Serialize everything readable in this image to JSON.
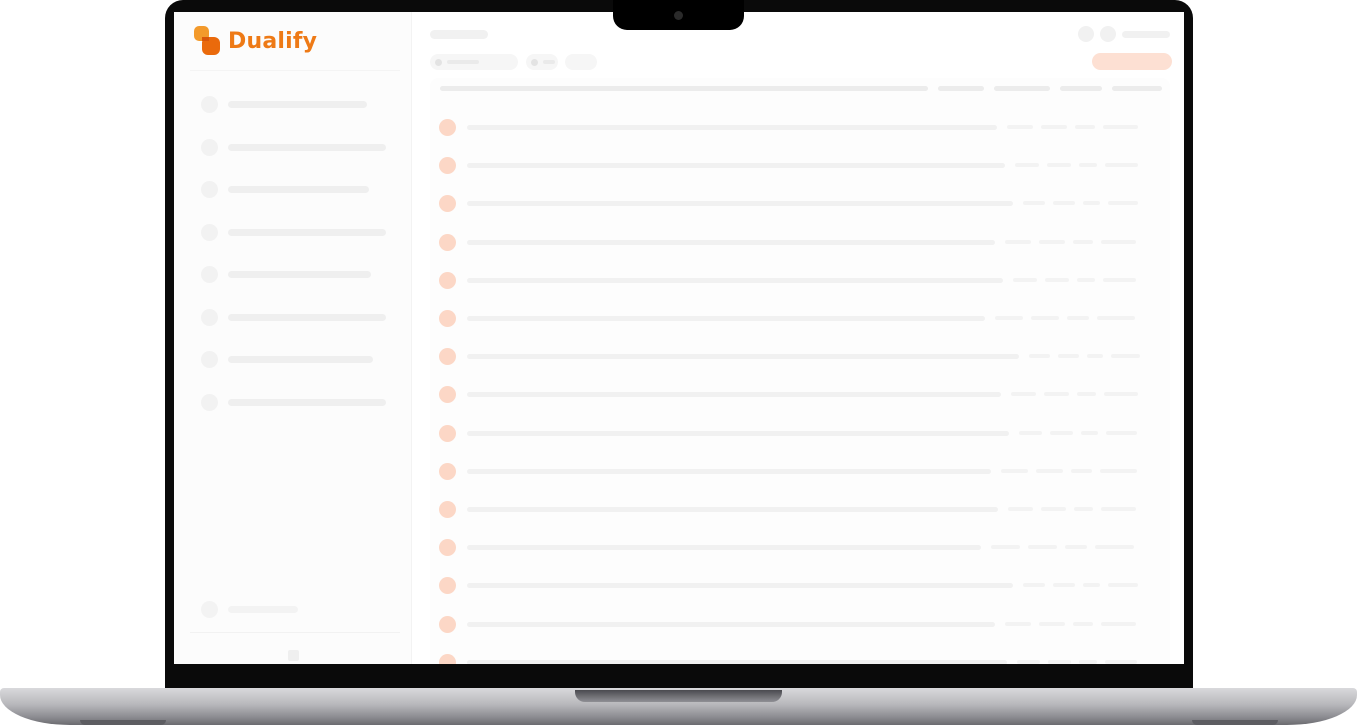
{
  "app": {
    "brand_name": "Dualify",
    "brand_color": "#ee7a16",
    "logo_icon": "dualify-logo-mark"
  },
  "colors": {
    "accent_soft": "#fde0d3",
    "row_avatar": "#fcd7c6",
    "skeleton": "#f1f1f1"
  },
  "sidebar": {
    "items": [
      {
        "icon": "nav-placeholder-icon"
      },
      {
        "icon": "nav-placeholder-icon"
      },
      {
        "icon": "nav-placeholder-icon"
      },
      {
        "icon": "nav-placeholder-icon"
      },
      {
        "icon": "nav-placeholder-icon"
      },
      {
        "icon": "nav-placeholder-icon"
      },
      {
        "icon": "nav-placeholder-icon"
      },
      {
        "icon": "nav-placeholder-icon"
      }
    ],
    "footer_icon": "collapse-icon"
  },
  "table": {
    "row_count": 15
  }
}
